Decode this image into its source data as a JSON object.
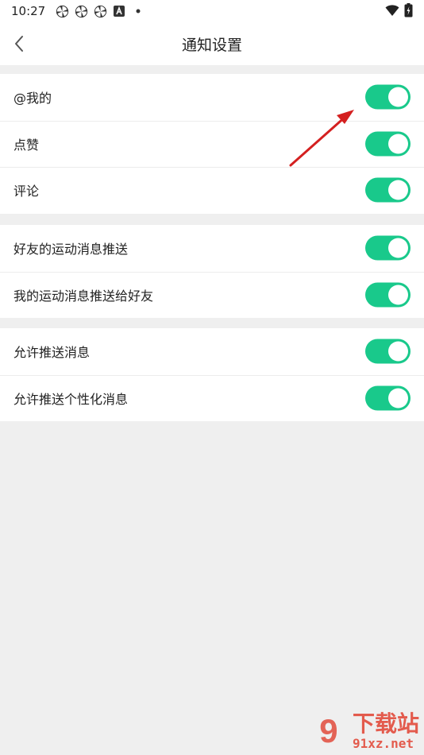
{
  "statusbar": {
    "time": "10:27",
    "left_icons": [
      "pinwheel-icon",
      "pinwheel-icon",
      "pinwheel-icon",
      "a-box-icon",
      "dot-icon"
    ],
    "right_icons": [
      "wifi-icon",
      "battery-charging-icon"
    ]
  },
  "header": {
    "title": "通知设置",
    "back_icon": "chevron-left-icon"
  },
  "groups": [
    {
      "rows": [
        {
          "label": "@我的",
          "enabled": true
        },
        {
          "label": "点赞",
          "enabled": true
        },
        {
          "label": "评论",
          "enabled": true
        }
      ]
    },
    {
      "rows": [
        {
          "label": "好友的运动消息推送",
          "enabled": true
        },
        {
          "label": "我的运动消息推送给好友",
          "enabled": true
        }
      ]
    },
    {
      "rows": [
        {
          "label": "允许推送消息",
          "enabled": true
        },
        {
          "label": "允许推送个性化消息",
          "enabled": true
        }
      ]
    }
  ],
  "colors": {
    "toggle_on": "#19c98b",
    "background": "#efefef",
    "annotation_arrow": "#d42020",
    "watermark": "#e24b3c"
  },
  "watermark": {
    "logo": "9",
    "name": "下载站",
    "url": "91xz.net"
  }
}
